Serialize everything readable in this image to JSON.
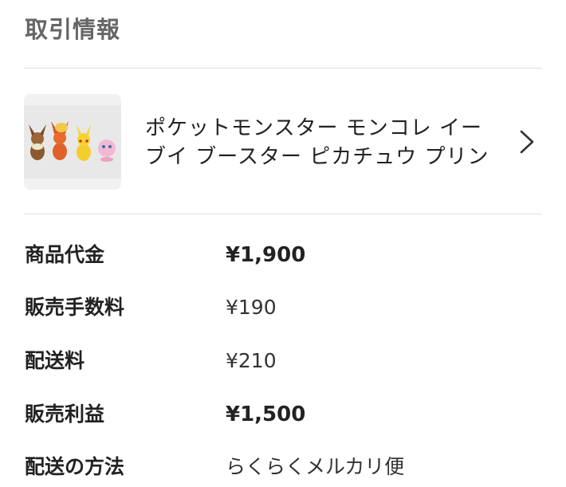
{
  "section": {
    "title": "取引情報"
  },
  "item": {
    "name": "ポケットモンスター モンコレ イーブイ ブースター ピカチュウ プリン",
    "thumbnail_icon": "product-thumbnail-image",
    "chevron_icon": "chevron-right-icon"
  },
  "details": [
    {
      "label": "商品代金",
      "value": "¥1,900"
    },
    {
      "label": "販売手数料",
      "value": "¥190"
    },
    {
      "label": "配送料",
      "value": "¥210"
    },
    {
      "label": "販売利益",
      "value": "¥1,500"
    },
    {
      "label": "配送の方法",
      "value": "らくらくメルカリ便"
    }
  ]
}
